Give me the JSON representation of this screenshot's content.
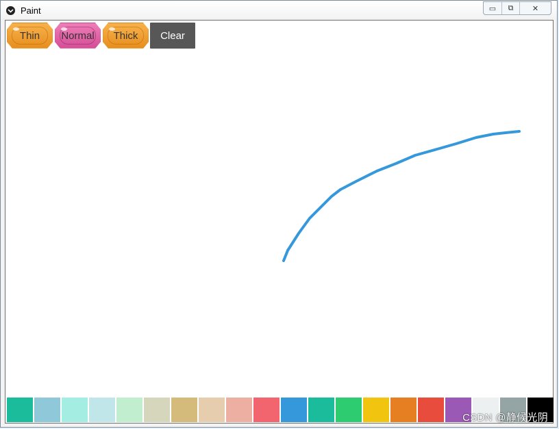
{
  "window": {
    "title": "Paint",
    "controls": {
      "minimize": "▭",
      "restore": "⧉",
      "close": "✕"
    }
  },
  "toolbar": {
    "thin_label": "Thin",
    "normal_label": "Normal",
    "thick_label": "Thick",
    "clear_label": "Clear"
  },
  "stroke": {
    "color": "#3498db"
  },
  "palette": {
    "colors": [
      "#1abc9c",
      "#8fc8d8",
      "#a3ede2",
      "#c0e6ea",
      "#c2eed0",
      "#d6d6bc",
      "#d4bb7b",
      "#e6cdae",
      "#ecafa2",
      "#f2646e",
      "#3498db",
      "#1abc9c",
      "#2ecc71",
      "#f1c40f",
      "#e67e22",
      "#e74c3c",
      "#9b59b6",
      "#ecf0f1",
      "#95a5a6",
      "#000000"
    ]
  },
  "watermark": "CSDN @静候光阴",
  "icons": {
    "app": "kivy-logo-icon"
  }
}
